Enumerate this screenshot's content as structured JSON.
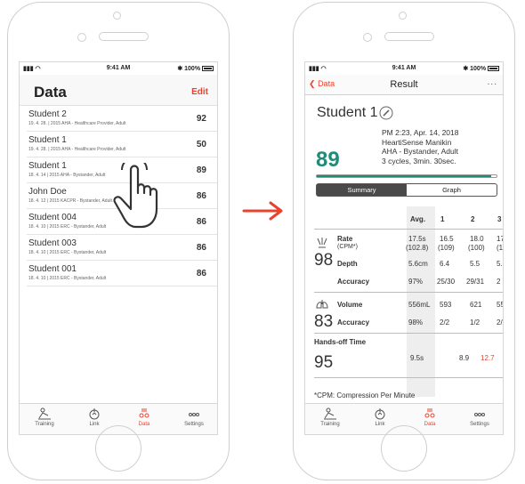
{
  "left_phone": {
    "status": {
      "time": "9:41 AM",
      "battery": "100%"
    },
    "header": {
      "title": "Data",
      "edit_label": "Edit"
    },
    "rows": [
      {
        "name": "Student 2",
        "meta": "19. 4. 28. | 2015 AHA - Healthcare Provider, Adult",
        "score": "92"
      },
      {
        "name": "Student 1",
        "meta": "19. 4. 28. | 2015 AHA - Healthcare Provider, Adult",
        "score": "50"
      },
      {
        "name": "Student 1",
        "meta": "18. 4. 14 | 2015 AHA - Bystander, Adult",
        "score": "89"
      },
      {
        "name": "John Doe",
        "meta": "18. 4. 12 | 2015 KACPR - Bystander, Adult",
        "score": "86"
      },
      {
        "name": "Student 004",
        "meta": "18. 4. 10 | 2015 ERC - Bystander, Adult",
        "score": "86"
      },
      {
        "name": "Student 003",
        "meta": "18. 4. 10 | 2015 ERC - Bystander, Adult",
        "score": "86"
      },
      {
        "name": "Student 001",
        "meta": "18. 4. 10 | 2015 ERC - Bystander, Adult",
        "score": "86"
      }
    ]
  },
  "tabs": {
    "training": "Training",
    "link": "Link",
    "data": "Data",
    "settings": "Settings"
  },
  "right_phone": {
    "status": {
      "time": "9:41 AM",
      "battery": "100%"
    },
    "nav": {
      "back_label": "Data",
      "title": "Result",
      "more": "..."
    },
    "student": "Student 1",
    "score": "89",
    "progress": 0.97,
    "info": {
      "line1": "PM 2:23, Apr. 14, 2018",
      "line2": "HeartiSense Manikin",
      "line3": "AHA - Bystander, Adult",
      "line4": "3 cycles, 3min. 30sec."
    },
    "segments": {
      "summary": "Summary",
      "graph": "Graph"
    },
    "table": {
      "headers": {
        "avg": "Avg.",
        "c1": "1",
        "c2": "2",
        "c3": "3"
      },
      "compression": {
        "score": "98",
        "rate_label": "Rate",
        "rate_sub": "(CPM*)",
        "rate_avg": "17.5s",
        "rate_avg2": "(102.8)",
        "rate_c1": "16.5",
        "rate_c1b": "(109)",
        "rate_c2": "18.0",
        "rate_c2b": "(100)",
        "rate_c3": "17",
        "rate_c3b": "(1",
        "depth_label": "Depth",
        "depth_avg": "5.6cm",
        "depth_c1": "6.4",
        "depth_c2": "5.5",
        "depth_c3": "5.",
        "acc_label": "Accuracy",
        "acc_avg": "97%",
        "acc_c1": "25/30",
        "acc_c2": "29/31",
        "acc_c3": "2"
      },
      "ventilation": {
        "score": "83",
        "vol_label": "Volume",
        "vol_avg": "556mL",
        "vol_c1": "593",
        "vol_c2": "621",
        "vol_c3": "55",
        "acc_label": "Accuracy",
        "acc_avg": "98%",
        "acc_c1": "2/2",
        "acc_c2": "1/2",
        "acc_c3": "2/"
      },
      "handsoff": {
        "label": "Hands-off Time",
        "score": "95",
        "avg": "9.5s",
        "c1": "8.9",
        "c2": "12.7"
      },
      "footnote": "*CPM: Compression Per Minute"
    }
  },
  "colors": {
    "accent": "#e8432e",
    "score_green": "#1f8c78"
  }
}
